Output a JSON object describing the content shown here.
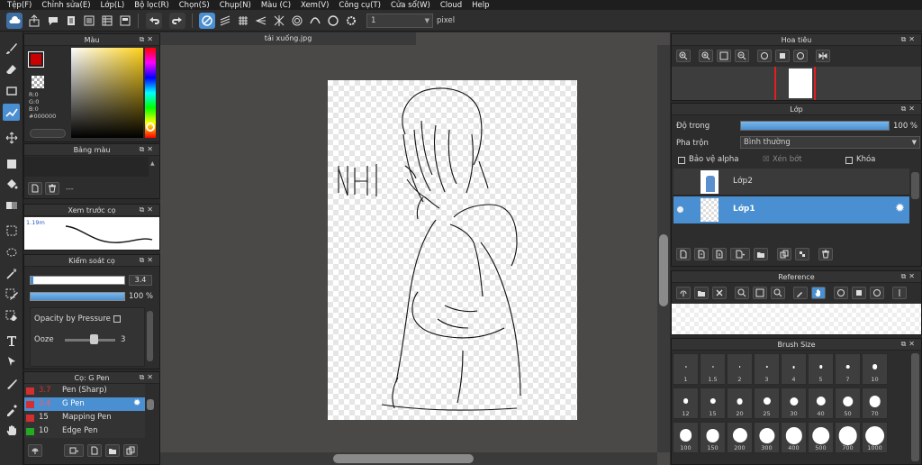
{
  "menu": [
    "Tệp(F)",
    "Chỉnh sửa(E)",
    "Lớp(L)",
    "Bộ lọc(R)",
    "Chọn(S)",
    "Chụp(N)",
    "Màu (C)",
    "Xem(V)",
    "Công cụ(T)",
    "Cửa sổ(W)",
    "Cloud",
    "Help"
  ],
  "toolbar": {
    "brush_size": "1",
    "unit": "pixel"
  },
  "color_panel": {
    "title": "Màu",
    "r": "R:0",
    "g": "G:0",
    "b": "B:0",
    "hex": "#000000",
    "fg": "#cc0000"
  },
  "palette": {
    "title": "Bảng màu",
    "value": "---"
  },
  "preview": {
    "title": "Xem trước cọ",
    "size": "1.19m"
  },
  "brush_control": {
    "title": "Kiểm soát cọ",
    "size": "3.4",
    "opacity": "100 %",
    "pressure_label": "Opacity by Pressure",
    "ooze_label": "Ooze",
    "ooze_value": "3"
  },
  "brush_list": {
    "title": "Cọ: G Pen",
    "items": [
      {
        "size": "3.7",
        "name": "Pen (Sharp)",
        "color": "#d23030"
      },
      {
        "size": "3.4",
        "name": "G Pen",
        "color": "#d23030"
      },
      {
        "size": "15",
        "name": "Mapping Pen",
        "color": "#d23030"
      },
      {
        "size": "10",
        "name": "Edge Pen",
        "color": "#22aa22"
      }
    ]
  },
  "canvas": {
    "tab": "tải xuống.jpg"
  },
  "navigator": {
    "title": "Hoa tiêu"
  },
  "layers": {
    "title": "Lớp",
    "opacity_label": "Độ trong",
    "opacity_value": "100 %",
    "blend_label": "Pha trộn",
    "blend_value": "Bình thường",
    "protect_alpha": "Bảo vệ alpha",
    "clipping": "Xén bớt",
    "lock": "Khóa",
    "items": [
      {
        "name": "Lớp2"
      },
      {
        "name": "Lớp1"
      }
    ]
  },
  "reference": {
    "title": "Reference"
  },
  "brush_size": {
    "title": "Brush Size",
    "sizes": [
      "1",
      "1.5",
      "2",
      "3",
      "4",
      "5",
      "7",
      "10",
      "12",
      "15",
      "20",
      "25",
      "30",
      "40",
      "50",
      "70",
      "100",
      "150",
      "200",
      "300",
      "400",
      "500",
      "700",
      "1000"
    ]
  },
  "accent": "#4a8fd1"
}
